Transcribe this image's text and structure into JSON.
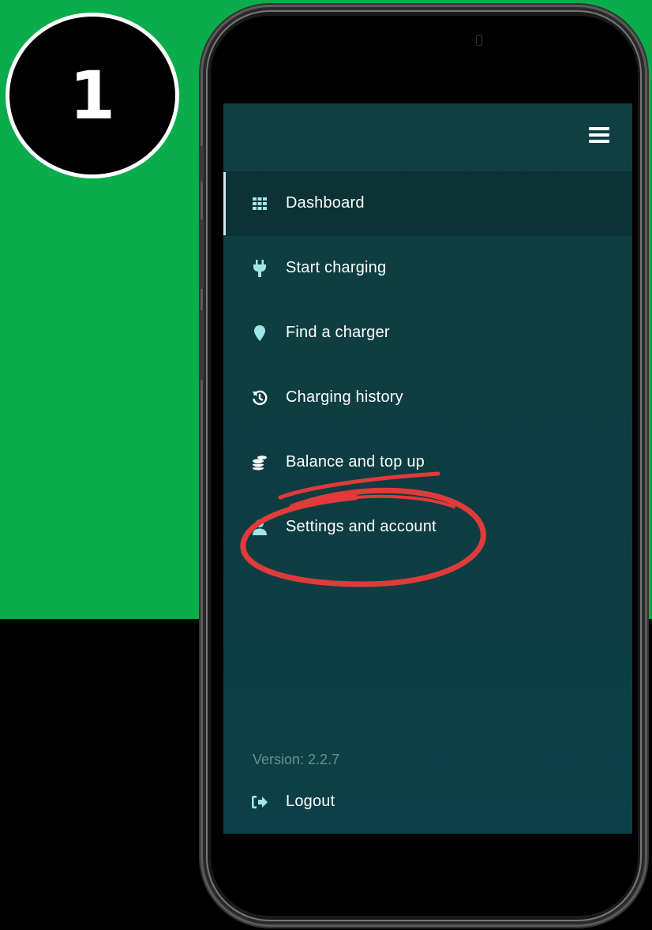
{
  "step": {
    "number": "1"
  },
  "menu": {
    "items": [
      {
        "label": "Dashboard",
        "icon": "grid-icon",
        "active": true
      },
      {
        "label": "Start charging",
        "icon": "plug-icon",
        "active": false
      },
      {
        "label": "Find a charger",
        "icon": "map-pin-icon",
        "active": false
      },
      {
        "label": "Charging history",
        "icon": "history-icon",
        "active": false
      },
      {
        "label": "Balance and top up",
        "icon": "coins-icon",
        "active": false
      },
      {
        "label": "Settings and account",
        "icon": "user-icon",
        "active": false,
        "highlighted": true
      }
    ],
    "version": "Version: 2.2.7",
    "logout_label": "Logout"
  },
  "colors": {
    "background_green": "#0aac4b",
    "app_background": "#0f3f42",
    "icon_color": "#9ee6ea",
    "annotation_red": "#e03a3a"
  }
}
